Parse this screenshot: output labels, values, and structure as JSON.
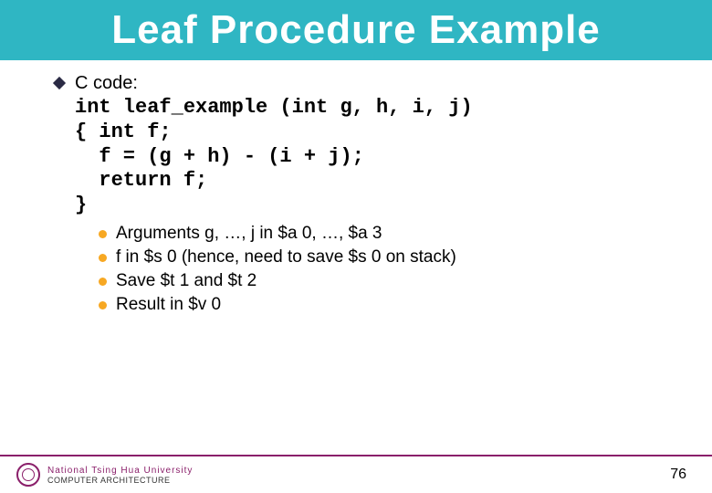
{
  "title": "Leaf Procedure Example",
  "section_label": "C code:",
  "code": "int leaf_example (int g, h, i, j)\n{ int f;\n  f = (g + h) - (i + j);\n  return f;\n}",
  "subpoints": [
    "Arguments g, …, j in $a 0, …, $a 3",
    "f in $s 0 (hence, need to save $s 0 on stack)",
    "Save $t 1 and $t 2",
    "Result in $v 0"
  ],
  "footer": {
    "university": "National Tsing Hua University",
    "dept": "COMPUTER ARCHITECTURE",
    "page": "76"
  }
}
